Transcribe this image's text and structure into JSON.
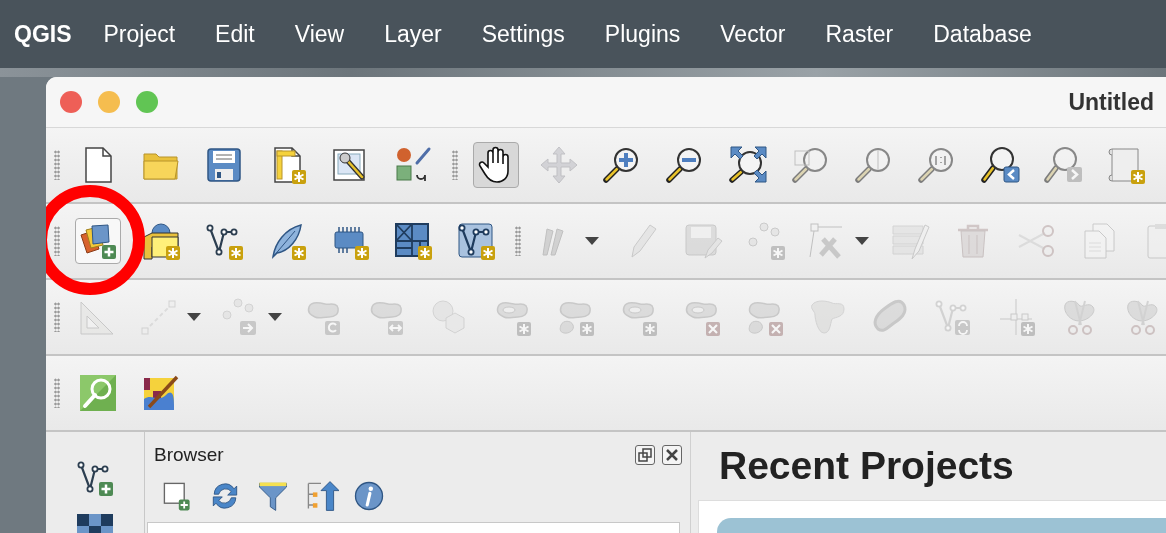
{
  "menu_bar": {
    "app": "QGIS",
    "items": [
      "Project",
      "Edit",
      "View",
      "Layer",
      "Settings",
      "Plugins",
      "Vector",
      "Raster",
      "Database"
    ]
  },
  "window": {
    "title": "Untitled"
  },
  "toolbar_rows": [
    {
      "toolbars": [
        {
          "items": [
            {
              "kind": "new-project",
              "disabled": false,
              "selected": false,
              "dropdown": false
            },
            {
              "kind": "open-project",
              "disabled": false,
              "selected": false,
              "dropdown": false
            },
            {
              "kind": "save-project",
              "disabled": false,
              "selected": false,
              "dropdown": false
            },
            {
              "kind": "new-layout",
              "disabled": false,
              "selected": false,
              "dropdown": false
            },
            {
              "kind": "project-properties",
              "disabled": false,
              "selected": false,
              "dropdown": false
            },
            {
              "kind": "style-manager",
              "disabled": false,
              "selected": false,
              "dropdown": false
            }
          ]
        },
        {
          "items": [
            {
              "kind": "pan",
              "disabled": false,
              "selected": true,
              "dropdown": false
            },
            {
              "kind": "pan-to-selection",
              "disabled": true,
              "selected": false,
              "dropdown": false
            },
            {
              "kind": "zoom-in",
              "disabled": false,
              "selected": false,
              "dropdown": false
            },
            {
              "kind": "zoom-out",
              "disabled": false,
              "selected": false,
              "dropdown": false
            },
            {
              "kind": "zoom-full",
              "disabled": false,
              "selected": false,
              "dropdown": false
            },
            {
              "kind": "zoom-selection",
              "disabled": true,
              "selected": false,
              "dropdown": false
            },
            {
              "kind": "zoom-layer",
              "disabled": true,
              "selected": false,
              "dropdown": false
            },
            {
              "kind": "zoom-native",
              "disabled": true,
              "selected": false,
              "dropdown": false
            },
            {
              "kind": "zoom-last",
              "disabled": false,
              "selected": false,
              "dropdown": false
            },
            {
              "kind": "zoom-next",
              "disabled": true,
              "selected": false,
              "dropdown": false
            },
            {
              "kind": "layout-manager",
              "disabled": false,
              "selected": false,
              "dropdown": false
            }
          ]
        }
      ]
    },
    {
      "toolbars": [
        {
          "items": [
            {
              "kind": "add-layer",
              "disabled": false,
              "selected": true,
              "dropdown": false
            },
            {
              "kind": "new-geopackage",
              "disabled": false,
              "selected": false,
              "dropdown": false
            },
            {
              "kind": "new-shapefile",
              "disabled": false,
              "selected": false,
              "dropdown": false
            },
            {
              "kind": "new-scratch",
              "disabled": false,
              "selected": false,
              "dropdown": false
            },
            {
              "kind": "new-temporary",
              "disabled": false,
              "selected": false,
              "dropdown": false
            },
            {
              "kind": "new-virtual",
              "disabled": false,
              "selected": false,
              "dropdown": false
            },
            {
              "kind": "new-vertex-layer",
              "disabled": false,
              "selected": false,
              "dropdown": false
            }
          ]
        },
        {
          "items": [
            {
              "kind": "current-edits",
              "disabled": true,
              "selected": false,
              "dropdown": true
            },
            {
              "kind": "toggle-editing",
              "disabled": true,
              "selected": false,
              "dropdown": false
            },
            {
              "kind": "save-edits",
              "disabled": true,
              "selected": false,
              "dropdown": false
            },
            {
              "kind": "add-points",
              "disabled": true,
              "selected": false,
              "dropdown": false
            },
            {
              "kind": "vertex-tool",
              "disabled": true,
              "selected": false,
              "dropdown": true
            },
            {
              "kind": "edit-table",
              "disabled": true,
              "selected": false,
              "dropdown": false
            },
            {
              "kind": "delete",
              "disabled": true,
              "selected": false,
              "dropdown": false
            },
            {
              "kind": "cut",
              "disabled": true,
              "selected": false,
              "dropdown": false
            },
            {
              "kind": "copy",
              "disabled": true,
              "selected": false,
              "dropdown": false
            },
            {
              "kind": "paste",
              "disabled": true,
              "selected": false,
              "dropdown": false
            }
          ]
        }
      ]
    },
    {
      "toolbars": [
        {
          "items": [
            {
              "kind": "ruler",
              "disabled": true,
              "selected": false,
              "dropdown": false
            },
            {
              "kind": "digitize-line",
              "disabled": true,
              "selected": false,
              "dropdown": true
            },
            {
              "kind": "move-points",
              "disabled": true,
              "selected": false,
              "dropdown": true
            },
            {
              "kind": "rotate-shape",
              "disabled": true,
              "selected": false,
              "dropdown": false
            },
            {
              "kind": "swap-shape",
              "disabled": true,
              "selected": false,
              "dropdown": false
            },
            {
              "kind": "offset-shape",
              "disabled": true,
              "selected": false,
              "dropdown": false
            },
            {
              "kind": "add-ring",
              "disabled": true,
              "selected": false,
              "dropdown": false
            },
            {
              "kind": "add-part",
              "disabled": true,
              "selected": false,
              "dropdown": false
            },
            {
              "kind": "fill-ring",
              "disabled": true,
              "selected": false,
              "dropdown": false
            },
            {
              "kind": "delete-ring",
              "disabled": true,
              "selected": false,
              "dropdown": false
            },
            {
              "kind": "delete-part",
              "disabled": true,
              "selected": false,
              "dropdown": false
            },
            {
              "kind": "reshape",
              "disabled": true,
              "selected": false,
              "dropdown": false
            },
            {
              "kind": "offset-curve",
              "disabled": true,
              "selected": false,
              "dropdown": false
            },
            {
              "kind": "reverse-line",
              "disabled": true,
              "selected": false,
              "dropdown": false
            },
            {
              "kind": "split-parts",
              "disabled": true,
              "selected": false,
              "dropdown": false
            },
            {
              "kind": "split-features",
              "disabled": true,
              "selected": false,
              "dropdown": false
            },
            {
              "kind": "split-features",
              "disabled": true,
              "selected": false,
              "dropdown": false
            }
          ]
        }
      ]
    },
    {
      "toolbars": [
        {
          "items": [
            {
              "kind": "locator",
              "disabled": false,
              "selected": false,
              "dropdown": false
            },
            {
              "kind": "map-edit",
              "disabled": false,
              "selected": false,
              "dropdown": false
            }
          ]
        }
      ]
    }
  ],
  "left_dock": {
    "items": [
      {
        "kind": "new-vertex"
      },
      {
        "kind": "grid"
      }
    ]
  },
  "browser": {
    "title": "Browser",
    "tools": [
      {
        "kind": "add-selected"
      },
      {
        "kind": "refresh"
      },
      {
        "kind": "filter"
      },
      {
        "kind": "collapse"
      },
      {
        "kind": "info"
      }
    ]
  },
  "welcome": {
    "heading": "Recent Projects"
  }
}
